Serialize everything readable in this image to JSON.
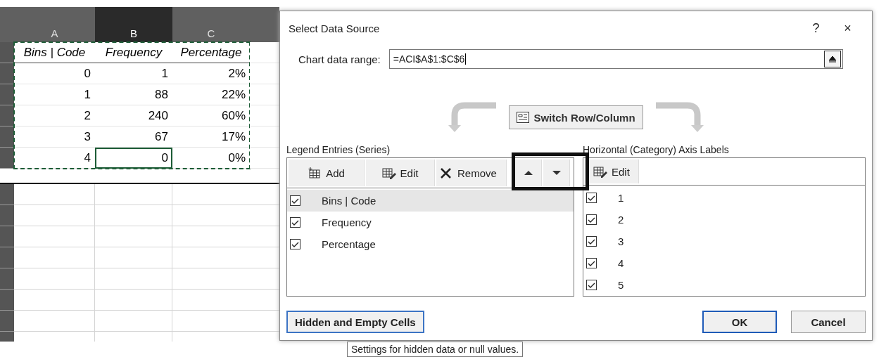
{
  "spreadsheet": {
    "columns": [
      {
        "label": "A",
        "selected": false
      },
      {
        "label": "B",
        "selected": true
      },
      {
        "label": "C",
        "selected": false
      }
    ],
    "header": [
      "Bins | Code",
      "Frequency",
      "Percentage"
    ],
    "rows": [
      {
        "cells": [
          {
            "text": "0",
            "selected": false
          },
          {
            "text": "1",
            "selected": false
          },
          {
            "text": "2%",
            "selected": false
          }
        ]
      },
      {
        "cells": [
          {
            "text": "1",
            "selected": false
          },
          {
            "text": "88",
            "selected": false
          },
          {
            "text": "22%",
            "selected": false
          }
        ]
      },
      {
        "cells": [
          {
            "text": "2",
            "selected": false
          },
          {
            "text": "240",
            "selected": false
          },
          {
            "text": "60%",
            "selected": false
          }
        ]
      },
      {
        "cells": [
          {
            "text": "3",
            "selected": false
          },
          {
            "text": "67",
            "selected": false
          },
          {
            "text": "17%",
            "selected": false
          }
        ]
      },
      {
        "cells": [
          {
            "text": "4",
            "selected": false
          },
          {
            "text": "0",
            "selected": true
          },
          {
            "text": "0%",
            "selected": false
          }
        ]
      }
    ]
  },
  "dialog": {
    "title": "Select Data Source",
    "help": "?",
    "close": "×",
    "range_label": "Chart data range:",
    "range_value": "=ACI$A$1:$C$6",
    "switch_button": "Switch Row/Column",
    "legend_label": "Legend Entries (Series)",
    "legend_toolbar": [
      {
        "kind": "add",
        "label": "Add"
      },
      {
        "kind": "edit",
        "label": "Edit"
      },
      {
        "kind": "remove",
        "label": "Remove"
      },
      {
        "kind": "up"
      },
      {
        "kind": "down"
      }
    ],
    "series": [
      {
        "label": "Bins | Code",
        "checked": true,
        "selected": true
      },
      {
        "label": "Frequency",
        "checked": true,
        "selected": false
      },
      {
        "label": "Percentage",
        "checked": true,
        "selected": false
      }
    ],
    "axis_label": "Horizontal (Category) Axis Labels",
    "axis_toolbar": [
      {
        "kind": "edit",
        "label": "Edit"
      }
    ],
    "categories": [
      {
        "label": "1",
        "checked": true
      },
      {
        "label": "2",
        "checked": true
      },
      {
        "label": "3",
        "checked": true
      },
      {
        "label": "4",
        "checked": true
      },
      {
        "label": "5",
        "checked": true
      }
    ],
    "hidden_button": "Hidden and Empty Cells",
    "ok_button": "OK",
    "cancel_button": "Cancel"
  },
  "tooltip": "Settings for hidden data or null values."
}
